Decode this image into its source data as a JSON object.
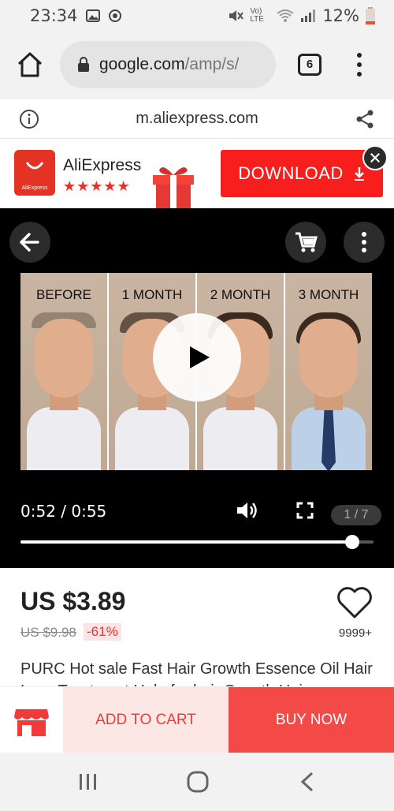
{
  "status": {
    "time": "23:34",
    "battery": "12%",
    "network": "Vo) LTE"
  },
  "browser": {
    "url_main": "google.com",
    "url_dim": "/amp/s/",
    "tab_count": "6"
  },
  "amp": {
    "domain": "m.aliexpress.com"
  },
  "banner": {
    "app_name": "AliExpress",
    "logo_text": "AliExpress",
    "stars": "★★★★★",
    "download_label": "DOWNLOAD"
  },
  "video": {
    "labels": [
      "BEFORE",
      "1 MONTH",
      "2 MONTH",
      "3 MONTH"
    ],
    "time": "0:52 / 0:55",
    "page": "1 / 7",
    "progress": 0.94
  },
  "product": {
    "price": "US $3.89",
    "old_price": "US $9.98",
    "discount": "-61%",
    "wish_count": "9999+",
    "title": "PURC Hot sale Fast Hair Growth Essence Oil Hair Loss Treatment Help for hair Growth Hair"
  },
  "actions": {
    "add_to_cart": "ADD TO CART",
    "buy_now": "BUY NOW"
  },
  "colors": {
    "accent": "#f81e1e",
    "buy": "#f44a47",
    "cart_bg": "#fde7e5"
  }
}
